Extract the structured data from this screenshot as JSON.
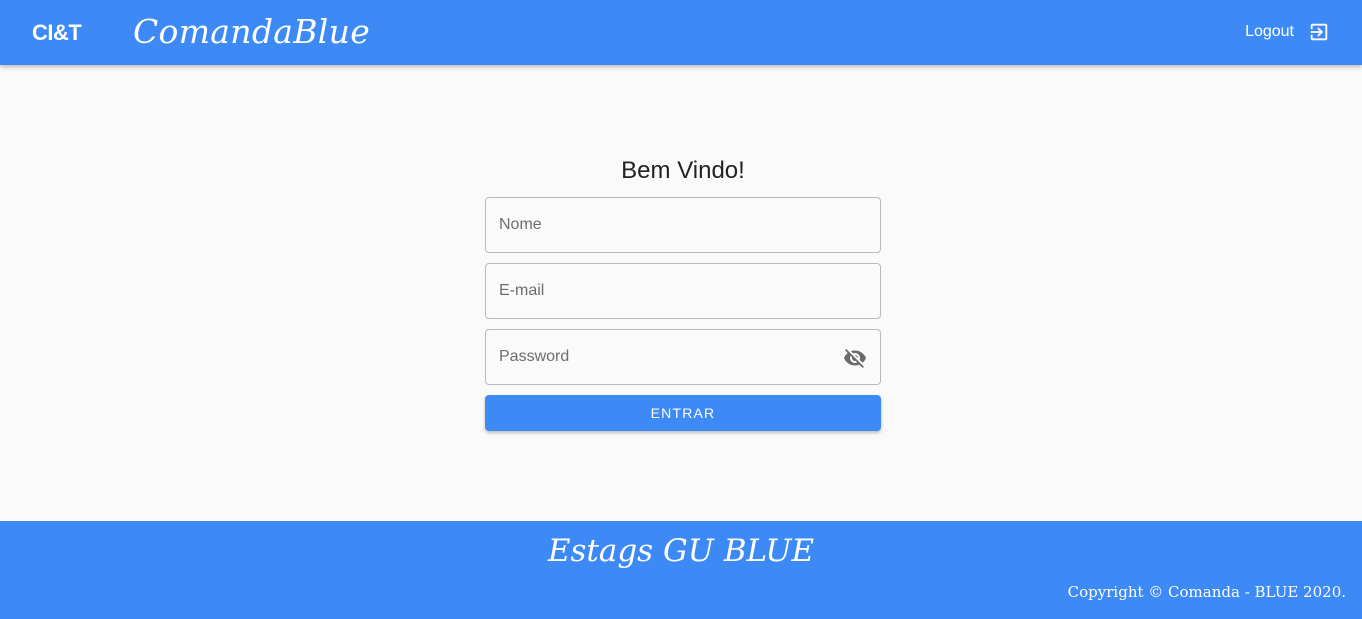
{
  "header": {
    "logo_text": "CI&T",
    "app_title": "ComandaBlue",
    "logout_label": "Logout",
    "logout_icon": "exit-to-app-icon"
  },
  "login": {
    "welcome": "Bem Vindo!",
    "name_placeholder": "Nome",
    "name_value": "",
    "email_placeholder": "E-mail",
    "email_value": "",
    "password_placeholder": "Password",
    "password_value": "",
    "password_toggle_icon": "visibility-off-icon",
    "submit_label": "ENTRAR"
  },
  "footer": {
    "title": "Estags GU BLUE",
    "copyright": "Copyright © Comanda - BLUE 2020."
  },
  "colors": {
    "primary": "#3d8af7",
    "background": "#fafafa",
    "text": "#222222"
  }
}
